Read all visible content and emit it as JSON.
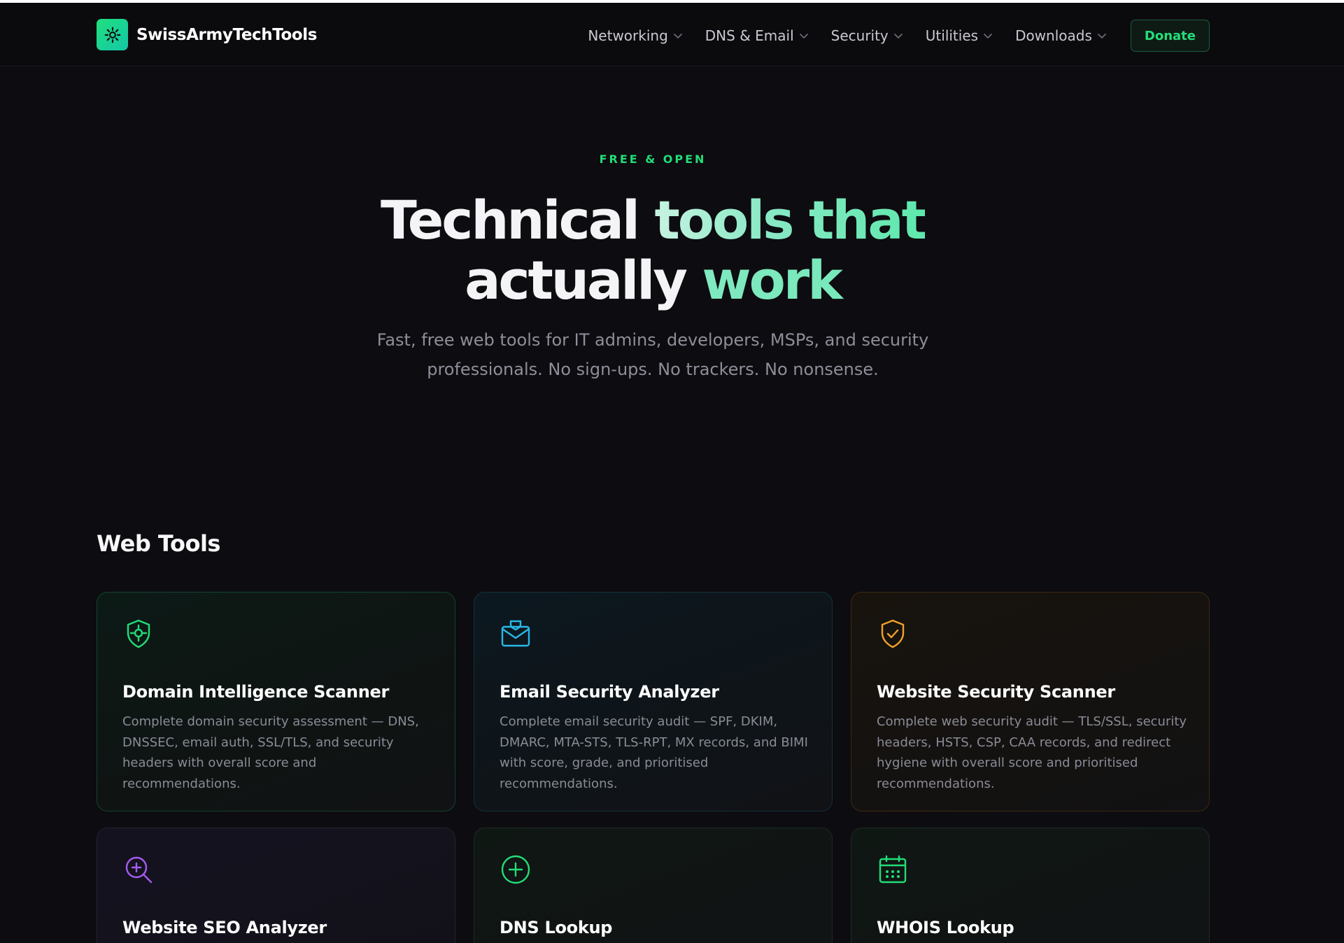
{
  "brand": {
    "name": "SwissArmyTechTools",
    "accent": "#22dd78"
  },
  "nav": {
    "items": [
      {
        "label": "Networking"
      },
      {
        "label": "DNS & Email"
      },
      {
        "label": "Security"
      },
      {
        "label": "Utilities"
      },
      {
        "label": "Downloads"
      }
    ],
    "donate_label": "Donate"
  },
  "hero": {
    "eyebrow": "FREE & OPEN",
    "title_part1": "Technical",
    "title_part2": "tools that",
    "title_part3": "actually",
    "title_part4": "work",
    "subtitle": "Fast, free web tools for IT admins, developers, MSPs, and security professionals. No sign-ups. No trackers. No nonsense."
  },
  "web_tools": {
    "heading": "Web Tools",
    "cards": [
      {
        "title": "Domain Intelligence Scanner",
        "description": "Complete domain security assessment — DNS, DNSSEC, email auth, SSL/TLS, and security headers with overall score and recommendations.",
        "icon": "shield-target-icon",
        "color": "#22dd78"
      },
      {
        "title": "Email Security Analyzer",
        "description": "Complete email security audit — SPF, DKIM, DMARC, MTA-STS, TLS-RPT, MX records, and BIMI with score, grade, and prioritised recommendations.",
        "icon": "mail-shield-icon",
        "color": "#29b8e8"
      },
      {
        "title": "Website Security Scanner",
        "description": "Complete web security audit — TLS/SSL, security headers, HSTS, CSP, CAA records, and redirect hygiene with overall score and prioritised recommendations.",
        "icon": "shield-check-icon",
        "color": "#f0a22a"
      },
      {
        "title": "Website SEO Analyzer",
        "description": "",
        "icon": "search-plus-icon",
        "color": "#a45cf0"
      },
      {
        "title": "DNS Lookup",
        "description": "",
        "icon": "plus-circle-icon",
        "color": "#22dd78"
      },
      {
        "title": "WHOIS Lookup",
        "description": "",
        "icon": "calendar-icon",
        "color": "#22dd78"
      }
    ]
  }
}
